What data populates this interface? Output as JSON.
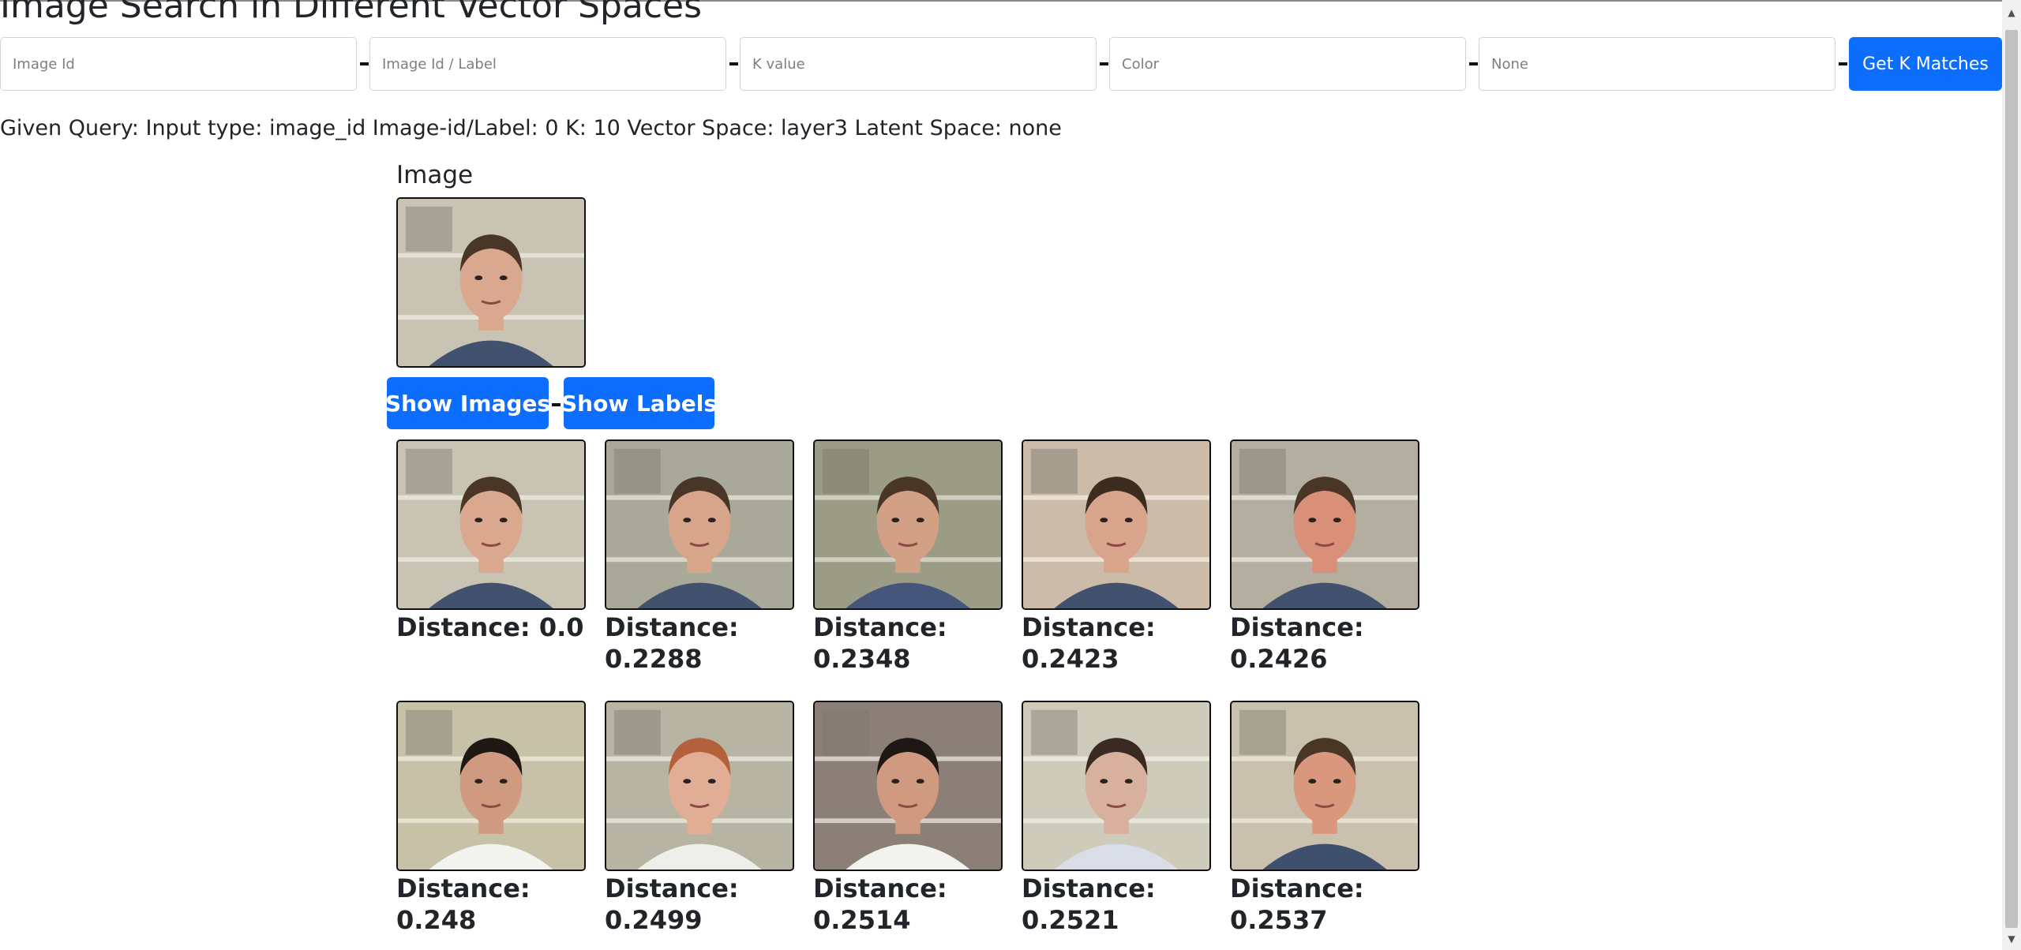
{
  "page": {
    "title": "Image Search in Different Vector Spaces"
  },
  "search": {
    "fields": [
      {
        "name": "image-id-input",
        "placeholder": "Image Id",
        "value": ""
      },
      {
        "name": "image-id-label-input",
        "placeholder": "Image Id / Label",
        "value": ""
      },
      {
        "name": "k-value-input",
        "placeholder": "K value",
        "value": ""
      },
      {
        "name": "vector-space-input",
        "placeholder": "Color",
        "value": ""
      },
      {
        "name": "latent-space-input",
        "placeholder": "None",
        "value": ""
      }
    ],
    "submit_label": "Get K Matches"
  },
  "query": {
    "text": "Given Query: Input type: image_id Image-id/Label: 0 K: 10 Vector Space: layer3 Latent Space: none"
  },
  "query_image": {
    "heading": "Image"
  },
  "view_buttons": {
    "show_images": "Show Images",
    "show_labels": "Show Labels"
  },
  "results": [
    {
      "distance_text": "Distance: 0.0"
    },
    {
      "distance_text": "Distance: 0.2288"
    },
    {
      "distance_text": "Distance: 0.2348"
    },
    {
      "distance_text": "Distance: 0.2423"
    },
    {
      "distance_text": "Distance: 0.2426"
    },
    {
      "distance_text": "Distance: 0.248"
    },
    {
      "distance_text": "Distance: 0.2499"
    },
    {
      "distance_text": "Distance: 0.2514"
    },
    {
      "distance_text": "Distance: 0.2521"
    },
    {
      "distance_text": "Distance: 0.2537"
    }
  ],
  "colors": {
    "accent": "#0d6efd",
    "text": "#212529",
    "border": "#ced4da"
  }
}
